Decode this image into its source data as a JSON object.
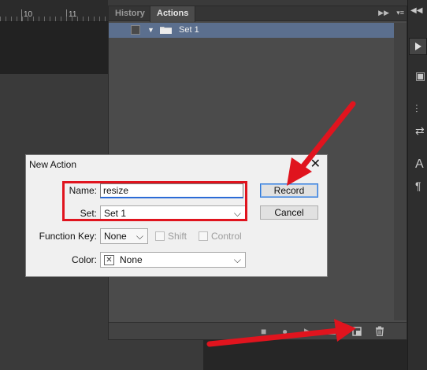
{
  "ruler": {
    "labels": [
      "10",
      "11"
    ]
  },
  "panel": {
    "tabs": [
      "History",
      "Actions"
    ],
    "active_tab": "Actions",
    "action_sets": [
      {
        "label": "Set 1"
      }
    ]
  },
  "dialog": {
    "title": "New Action",
    "name_label": "Name:",
    "name_value": "resize",
    "set_label": "Set:",
    "set_value": "Set 1",
    "function_key_label": "Function Key:",
    "function_key_value": "None",
    "shift_label": "Shift",
    "control_label": "Control",
    "color_label": "Color:",
    "color_value": "None",
    "record_button": "Record",
    "cancel_button": "Cancel"
  },
  "colors": {
    "annotation_red": "#e0141e",
    "selection_blue": "#5b6f8e",
    "panel_bg": "#4b4b4b"
  },
  "icons": {
    "panel_footer": [
      "stop-icon",
      "record-icon",
      "play-icon",
      "new-set-icon",
      "new-action-icon",
      "delete-icon"
    ],
    "annotations": [
      "arrow-to-record-button",
      "arrow-to-new-action-button"
    ]
  }
}
